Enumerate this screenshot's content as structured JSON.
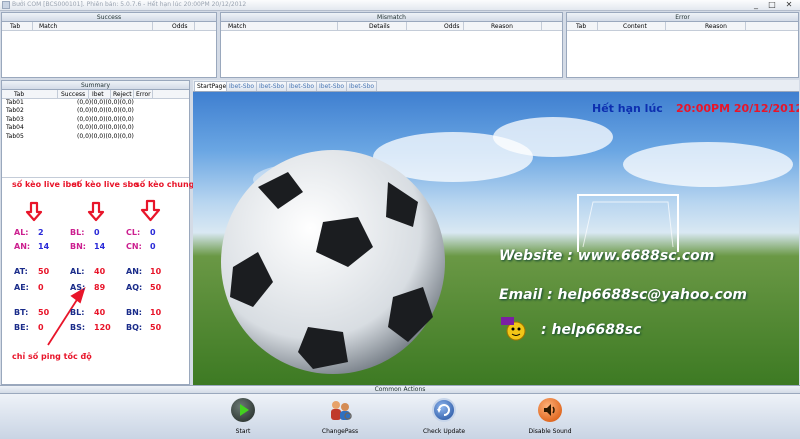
{
  "window": {
    "title": "Bưởi COM [BCS000101]. Phiên bản: 5.0.7.6 - Hết hạn lúc 20:00PM 20/12/2012",
    "minimize": "_",
    "maximize": "□",
    "close": "✕"
  },
  "success_panel": {
    "title": "Success",
    "columns": [
      "Tab",
      "Match",
      "Odds"
    ]
  },
  "mismatch_panel": {
    "title": "Mismatch",
    "columns": [
      "Match",
      "Details",
      "Odds",
      "Reason"
    ]
  },
  "error_panel": {
    "title": "Error",
    "columns": [
      "Tab",
      "Content",
      "Reason"
    ]
  },
  "summary": {
    "title": "Summary",
    "columns": [
      "Tab",
      "Success",
      "Ibet",
      "Reject",
      "Error"
    ],
    "rows": [
      {
        "tab": "Tab01",
        "value": "(0,0)(0,0)(0,0)(0,0)"
      },
      {
        "tab": "Tab02",
        "value": "(0,0)(0,0)(0,0)(0,0)"
      },
      {
        "tab": "Tab03",
        "value": "(0,0)(0,0)(0,0)(0,0)"
      },
      {
        "tab": "Tab04",
        "value": "(0,0)(0,0)(0,0)(0,0)"
      },
      {
        "tab": "Tab05",
        "value": "(0,0)(0,0)(0,0)(0,0)"
      }
    ]
  },
  "annotations": {
    "live_ibet": "số kèo live ibet",
    "live_sbo": "số kèo live sbo",
    "common": "số kèo chung",
    "ping": "chỉ số ping tốc độ"
  },
  "stats": {
    "AL": {
      "label": "AL:",
      "value": "2"
    },
    "AN": {
      "label": "AN:",
      "value": "14"
    },
    "BL": {
      "label": "BL:",
      "value": "0"
    },
    "BN": {
      "label": "BN:",
      "value": "14"
    },
    "CL": {
      "label": "CL:",
      "value": "0"
    },
    "CN": {
      "label": "CN:",
      "value": "0"
    },
    "AT": {
      "label": "AT:",
      "value": "50"
    },
    "AL2": {
      "label": "AL:",
      "value": "40"
    },
    "AN2": {
      "label": "AN:",
      "value": "10"
    },
    "AE": {
      "label": "AE:",
      "value": "0"
    },
    "AS": {
      "label": "AS:",
      "value": "89"
    },
    "AQ": {
      "label": "AQ:",
      "value": "50"
    },
    "BT": {
      "label": "BT:",
      "value": "50"
    },
    "BL2": {
      "label": "BL:",
      "value": "40"
    },
    "BN2": {
      "label": "BN:",
      "value": "10"
    },
    "BE": {
      "label": "BE:",
      "value": "0"
    },
    "BS": {
      "label": "BS:",
      "value": "120"
    },
    "BQ": {
      "label": "BQ:",
      "value": "50"
    }
  },
  "tabs": [
    "StartPage",
    "Ibet-Sbo",
    "Ibet-Sbo",
    "Ibet-Sbo",
    "Ibet-Sbo",
    "Ibet-Sbo"
  ],
  "startpage": {
    "expiry_label": "Hết hạn lúc",
    "expiry_value": "20:00PM 20/12/2012",
    "website": "Website : www.6688sc.com",
    "email": "Email : help6688sc@yahoo.com",
    "yahoo": ": help6688sc"
  },
  "common_actions": {
    "title": "Common Actions",
    "start": "Start",
    "change_pass": "ChangePass",
    "check_update": "Check Update",
    "disable_sound": "Disable Sound"
  },
  "colors": {
    "annotation": "#e8152a",
    "value": "#2a2ad8",
    "stat_label": "#cc1f8f",
    "stat_label_b": "#1a2c8a"
  }
}
